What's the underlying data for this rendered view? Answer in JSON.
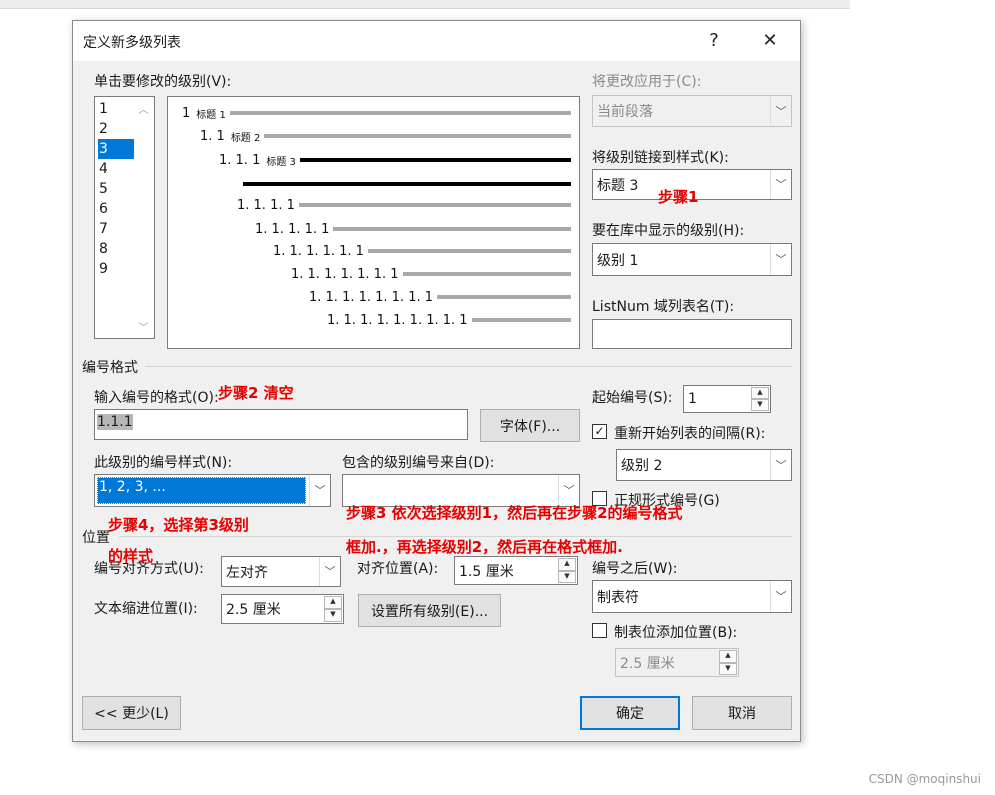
{
  "dialog": {
    "title": "定义新多级列表",
    "help_glyph": "?",
    "close_glyph": "✕"
  },
  "levels": {
    "label": "单击要修改的级别(V):",
    "items": [
      "1",
      "2",
      "3",
      "4",
      "5",
      "6",
      "7",
      "8",
      "9"
    ],
    "selected": "3",
    "scroll_up": "︿",
    "scroll_down": "﹀"
  },
  "preview": {
    "rows": [
      {
        "num": "1",
        "style": "标题 1"
      },
      {
        "num": "1. 1",
        "style": "标题 2"
      },
      {
        "num": "1. 1. 1",
        "style": "标题 3"
      },
      {
        "num": "",
        "style": ""
      },
      {
        "num": "1. 1. 1. 1",
        "style": ""
      },
      {
        "num": "1. 1. 1. 1. 1",
        "style": ""
      },
      {
        "num": "1. 1. 1. 1. 1. 1",
        "style": ""
      },
      {
        "num": "1. 1. 1. 1. 1. 1. 1",
        "style": ""
      },
      {
        "num": "1. 1. 1. 1. 1. 1. 1. 1",
        "style": ""
      },
      {
        "num": "1. 1. 1. 1. 1. 1. 1. 1. 1",
        "style": ""
      }
    ]
  },
  "right_panel": {
    "apply_to_label": "将更改应用于(C):",
    "apply_to_value": "当前段落",
    "link_style_label": "将级别链接到样式(K):",
    "link_style_value": "标题 3",
    "gallery_level_label": "要在库中显示的级别(H):",
    "gallery_level_value": "级别 1",
    "listnum_label": "ListNum 域列表名(T):",
    "listnum_value": ""
  },
  "number_format": {
    "section_label": "编号格式",
    "enter_format_label": "输入编号的格式(O):",
    "format_value": "1.1.1",
    "font_button": "字体(F)...",
    "style_label": "此级别的编号样式(N):",
    "style_value": "1, 2, 3, ...",
    "include_label": "包含的级别编号来自(D):",
    "include_value": "",
    "start_at_label": "起始编号(S):",
    "start_at_value": "1",
    "restart_label": "重新开始列表的间隔(R):",
    "restart_checked": true,
    "restart_value": "级别 2",
    "legal_label": "正规形式编号(G)",
    "legal_checked": false
  },
  "position": {
    "section_label": "位置",
    "alignment_label": "编号对齐方式(U):",
    "alignment_value": "左对齐",
    "aligned_at_label": "对齐位置(A):",
    "aligned_at_value": "1.5 厘米",
    "indent_label": "文本缩进位置(I):",
    "indent_value": "2.5 厘米",
    "set_all_button": "设置所有级别(E)...",
    "follow_label": "编号之后(W):",
    "follow_value": "制表符",
    "tab_stop_label": "制表位添加位置(B):",
    "tab_stop_checked": false,
    "tab_stop_value": "2.5 厘米"
  },
  "footer": {
    "less_button": "<< 更少(L)",
    "ok_button": "确定",
    "cancel_button": "取消"
  },
  "annotations": {
    "step1": "步骤1",
    "step2": "步骤2 清空",
    "step3_line1": "步骤3 依次选择级别1，然后再在步骤2的编号格式",
    "step3_line2": "框加.，再选择级别2，然后再在格式框加.",
    "step4_line1": "步骤4，选择第3级别",
    "step4_line2": "的样式"
  },
  "watermark": "CSDN @moqinshui",
  "colors": {
    "annotation": "#e60000",
    "selection": "#0078d7",
    "dialog_bg": "#f0f0f0"
  }
}
